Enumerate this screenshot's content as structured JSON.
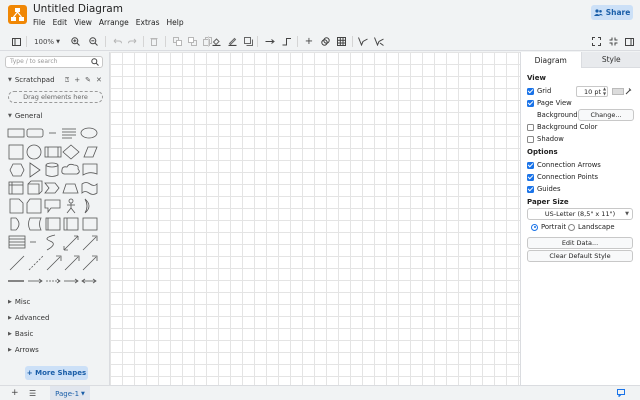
{
  "app": {
    "title": "Untitled Diagram",
    "share_label": "Share",
    "accent": "#1a5ea8",
    "logo_color": "#f08705"
  },
  "menu": [
    "File",
    "Edit",
    "View",
    "Arrange",
    "Extras",
    "Help"
  ],
  "toolbar": {
    "zoom": "100%",
    "icons": [
      "format-panel-icon",
      "zoom-dropdown",
      "zoom-in-icon",
      "zoom-out-icon",
      "undo-icon",
      "redo-icon",
      "delete-icon",
      "to-front-icon",
      "to-back-icon",
      "fill-color-icon",
      "line-color-icon",
      "shadow-icon",
      "connection-icon",
      "waypoints-icon",
      "insert-icon",
      "link-icon",
      "table-icon",
      "fullscreen-icon",
      "collapse-icon"
    ]
  },
  "sidebar": {
    "search_placeholder": "Type / to search",
    "scratchpad_label": "Scratchpad",
    "drag_label": "Drag elements here",
    "general_label": "General",
    "collapsed_sections": [
      "Misc",
      "Advanced",
      "Basic",
      "Arrows"
    ],
    "more_shapes_label": "+ More Shapes"
  },
  "format_panel": {
    "tabs": [
      "Diagram",
      "Style"
    ],
    "view_heading": "View",
    "grid_label": "Grid",
    "grid_checked": true,
    "grid_size": "10 pt",
    "page_view_label": "Page View",
    "page_view_checked": true,
    "background_label": "Background",
    "change_label": "Change...",
    "background_color_label": "Background Color",
    "background_color_checked": false,
    "shadow_label": "Shadow",
    "shadow_checked": false,
    "options_heading": "Options",
    "connection_arrows_label": "Connection Arrows",
    "connection_arrows_checked": true,
    "connection_points_label": "Connection Points",
    "connection_points_checked": true,
    "guides_label": "Guides",
    "guides_checked": true,
    "paper_size_heading": "Paper Size",
    "paper_size_value": "US-Letter (8,5\" x 11\")",
    "portrait_label": "Portrait",
    "portrait_selected": true,
    "landscape_label": "Landscape",
    "edit_data_label": "Edit Data...",
    "clear_default_style_label": "Clear Default Style"
  },
  "bottom": {
    "page_label": "Page-1"
  }
}
